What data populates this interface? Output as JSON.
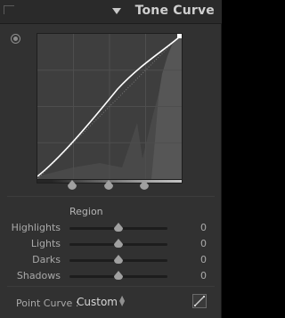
{
  "panel": {
    "title": "Tone Curve",
    "collapse_icon": "triangle-down-icon",
    "target_icon": "target-adjust-icon"
  },
  "region": {
    "label": "Region",
    "sliders": [
      {
        "label": "Highlights",
        "value": "0"
      },
      {
        "label": "Lights",
        "value": "0"
      },
      {
        "label": "Darks",
        "value": "0"
      },
      {
        "label": "Shadows",
        "value": "0"
      }
    ]
  },
  "point_curve": {
    "label": "Point Curve :",
    "value": "Custom",
    "edit_icon": "point-curve-edit-icon"
  },
  "colors": {
    "panel_bg": "#313131",
    "curve_bg": "#3e3e3e",
    "curve_line": "#ffffff",
    "text": "#a9a9a9",
    "title": "#cfcfcf"
  }
}
